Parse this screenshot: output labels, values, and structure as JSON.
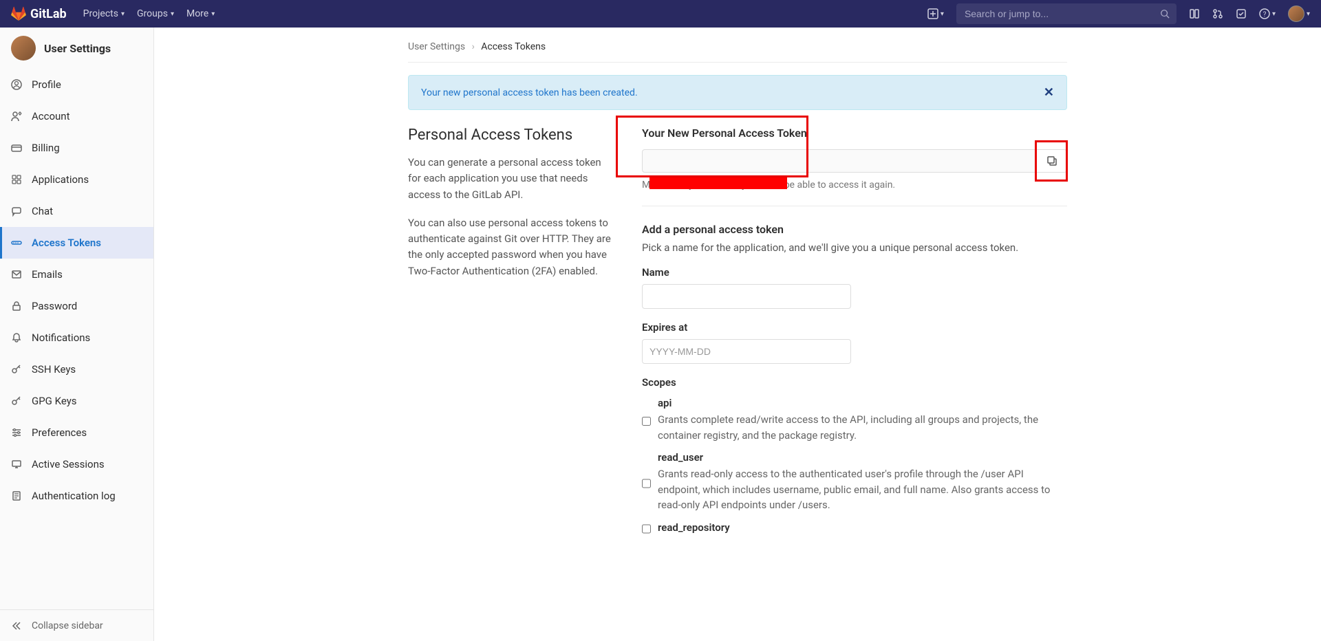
{
  "brand": "GitLab",
  "nav": {
    "projects": "Projects",
    "groups": "Groups",
    "more": "More",
    "search_placeholder": "Search or jump to..."
  },
  "sidebar_title": "User Settings",
  "sidebar": {
    "items": [
      {
        "label": "Profile"
      },
      {
        "label": "Account"
      },
      {
        "label": "Billing"
      },
      {
        "label": "Applications"
      },
      {
        "label": "Chat"
      },
      {
        "label": "Access Tokens"
      },
      {
        "label": "Emails"
      },
      {
        "label": "Password"
      },
      {
        "label": "Notifications"
      },
      {
        "label": "SSH Keys"
      },
      {
        "label": "GPG Keys"
      },
      {
        "label": "Preferences"
      },
      {
        "label": "Active Sessions"
      },
      {
        "label": "Authentication log"
      }
    ],
    "collapse": "Collapse sidebar"
  },
  "breadcrumb": {
    "root": "User Settings",
    "current": "Access Tokens"
  },
  "alert_text": "Your new personal access token has been created.",
  "page": {
    "heading": "Personal Access Tokens",
    "p1": "You can generate a personal access token for each application you use that needs access to the GitLab API.",
    "p2": "You can also use personal access tokens to authenticate against Git over HTTP. They are the only accepted password when you have Two-Factor Authentication (2FA) enabled."
  },
  "token": {
    "heading": "Your New Personal Access Token",
    "hint": "Make sure you save it - you won't be able to access it again."
  },
  "form": {
    "heading": "Add a personal access token",
    "sub": "Pick a name for the application, and we'll give you a unique personal access token.",
    "name_label": "Name",
    "expires_label": "Expires at",
    "expires_placeholder": "YYYY-MM-DD",
    "scopes_label": "Scopes",
    "scopes": [
      {
        "name": "api",
        "desc": "Grants complete read/write access to the API, including all groups and projects, the container registry, and the package registry."
      },
      {
        "name": "read_user",
        "desc": "Grants read-only access to the authenticated user's profile through the /user API endpoint, which includes username, public email, and full name. Also grants access to read-only API endpoints under /users."
      },
      {
        "name": "read_repository",
        "desc": ""
      }
    ]
  }
}
